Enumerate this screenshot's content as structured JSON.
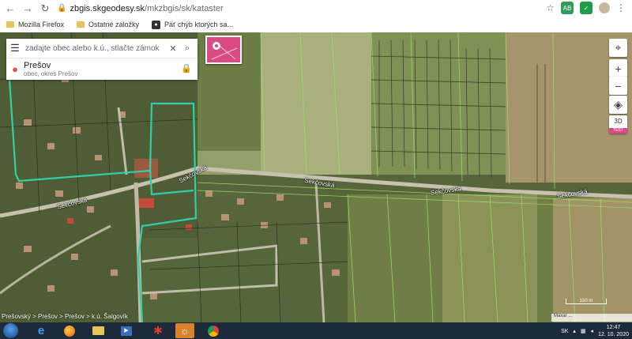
{
  "browser": {
    "url_host": "zbgis.skgeodesy.sk",
    "url_path": "/mkzbgis/sk/kataster",
    "bookmarks": [
      {
        "label": "Mozilla Firefox",
        "icon": "folder-icon"
      },
      {
        "label": "Ostatné záložky",
        "icon": "folder-icon"
      },
      {
        "label": "Päť chýb ktorých sa...",
        "icon": "bookmark-site-icon"
      }
    ]
  },
  "search": {
    "placeholder": "zadajte obec alebo k.ú., stlačte zámok",
    "place_name": "Prešov",
    "place_sub": "obec, okres Prešov"
  },
  "controls": {
    "btn_3d": "3D",
    "btn_3d_tag": "TEST"
  },
  "roads": {
    "a": "Sekčovská",
    "b": "Sekčovská",
    "c": "Sekčovská",
    "d": "Sekčovská",
    "e": "Sekčovská"
  },
  "breadcrumb": "Prešovský > Prešov > Prešov > k.ú. Šalgovík",
  "attribution": "Maxar ...",
  "scale": "150 m",
  "taskbar": {
    "lang": "SK",
    "time": "12:47",
    "date": "12. 10. 2020"
  },
  "colors": {
    "accent": "#d94a86",
    "selection": "#2fd0a8"
  }
}
